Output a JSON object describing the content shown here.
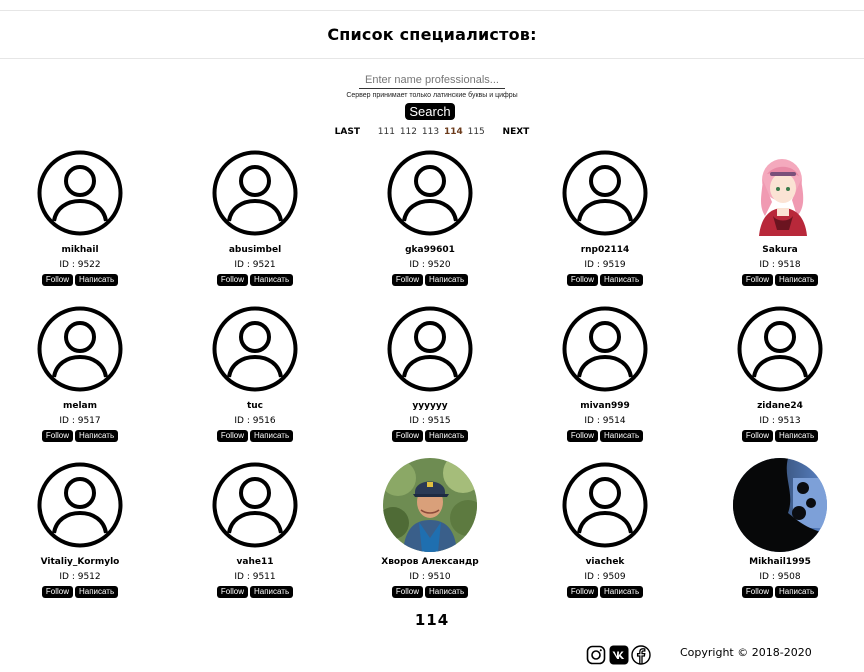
{
  "header": {
    "title": "Список специалистов:"
  },
  "search": {
    "placeholder": "Enter name professionals...",
    "hint": "Сервер принимает только латинские буквы и цифры",
    "button_label": "Search"
  },
  "pagination": {
    "last_label": "LAST",
    "pages": [
      "111",
      "112",
      "113",
      "114",
      "115"
    ],
    "current": "114",
    "next_label": "NEXT"
  },
  "card_labels": {
    "follow": "Follow",
    "message": "Написать",
    "id_prefix": "ID : "
  },
  "specialists": [
    {
      "name": "mikhail",
      "id": "9522",
      "avatar": "default-user-icon"
    },
    {
      "name": "abusimbel",
      "id": "9521",
      "avatar": "default-user-icon"
    },
    {
      "name": "gka99601",
      "id": "9520",
      "avatar": "default-user-icon"
    },
    {
      "name": "rnp02114",
      "id": "9519",
      "avatar": "default-user-icon"
    },
    {
      "name": "Sakura",
      "id": "9518",
      "avatar": "anime-girl-photo"
    },
    {
      "name": "melam",
      "id": "9517",
      "avatar": "default-user-icon"
    },
    {
      "name": "tuc",
      "id": "9516",
      "avatar": "default-user-icon"
    },
    {
      "name": "yyyyyy",
      "id": "9515",
      "avatar": "default-user-icon"
    },
    {
      "name": "mivan999",
      "id": "9514",
      "avatar": "default-user-icon"
    },
    {
      "name": "zidane24",
      "id": "9513",
      "avatar": "default-user-icon"
    },
    {
      "name": "Vitaliy_Kormylo",
      "id": "9512",
      "avatar": "default-user-icon"
    },
    {
      "name": "vahe11",
      "id": "9511",
      "avatar": "default-user-icon"
    },
    {
      "name": "Хворов Александр",
      "id": "9510",
      "avatar": "man-photo"
    },
    {
      "name": "viachek",
      "id": "9509",
      "avatar": "default-user-icon"
    },
    {
      "name": "Mikhail1995",
      "id": "9508",
      "avatar": "night-trees-photo"
    }
  ],
  "footer": {
    "page_number": "114",
    "social_icons": [
      "instagram-icon",
      "vk-icon",
      "facebook-icon"
    ],
    "copyright": "Copyright © 2018-2020"
  }
}
